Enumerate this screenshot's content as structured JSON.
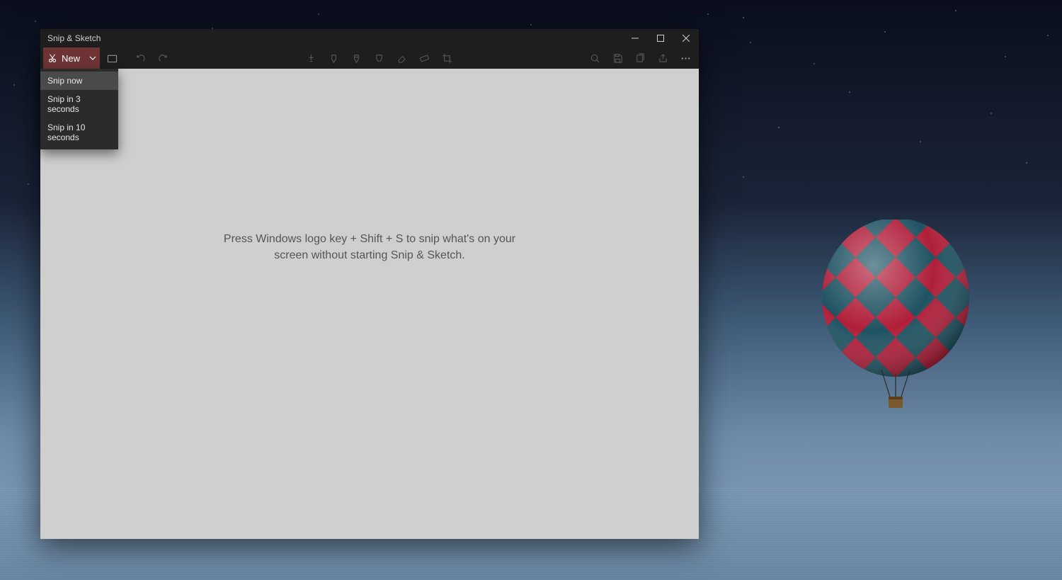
{
  "window": {
    "title": "Snip & Sketch"
  },
  "toolbar": {
    "new_label": "New"
  },
  "dropdown": {
    "items": [
      "Snip now",
      "Snip in 3 seconds",
      "Snip in 10 seconds"
    ]
  },
  "canvas": {
    "hint": "Press Windows logo key + Shift + S to snip what's on your screen without starting Snip & Sketch."
  }
}
